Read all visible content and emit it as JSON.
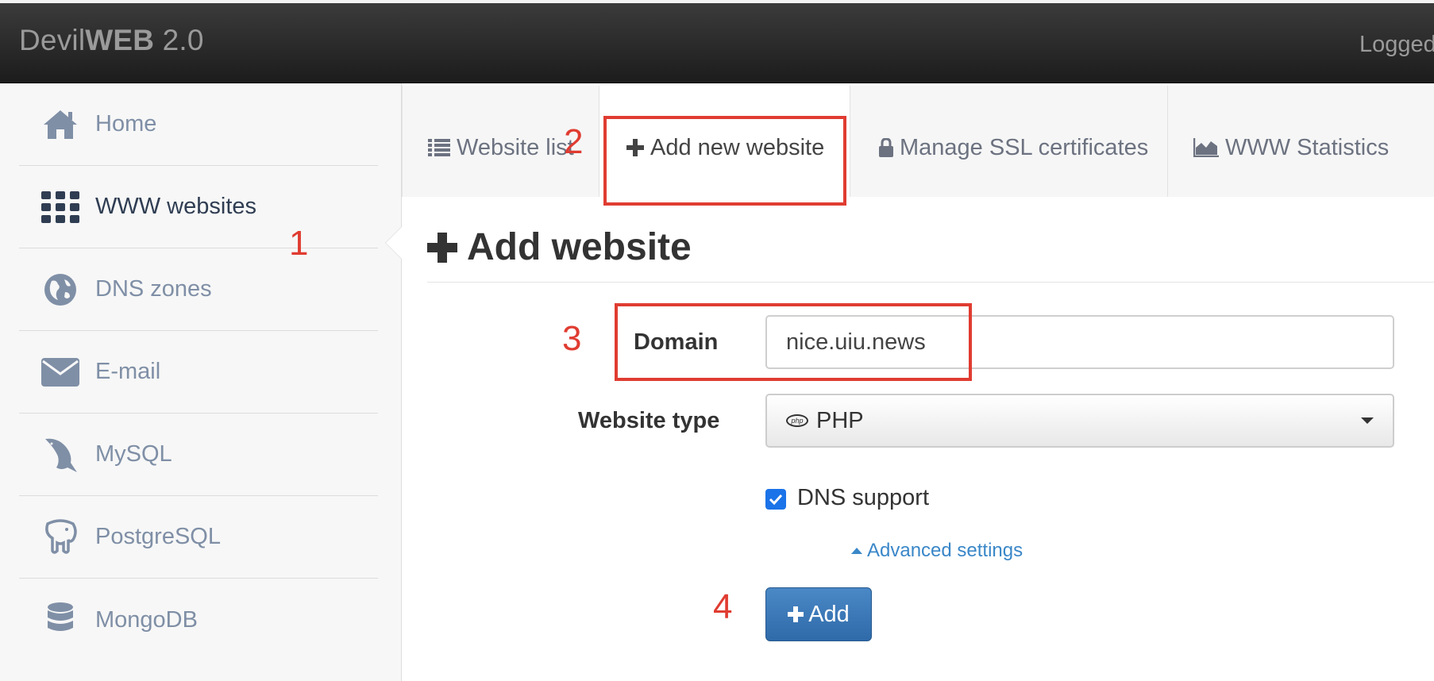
{
  "navbar": {
    "brand_light": "Devil",
    "brand_bold": "WEB",
    "brand_version": " 2.0",
    "logged_text": "Logged"
  },
  "sidebar": {
    "items": [
      {
        "label": "Home",
        "icon": "home-icon",
        "active": false
      },
      {
        "label": "WWW websites",
        "icon": "grid-icon",
        "active": true
      },
      {
        "label": "DNS zones",
        "icon": "globe-icon",
        "active": false
      },
      {
        "label": "E-mail",
        "icon": "envelope-icon",
        "active": false
      },
      {
        "label": "MySQL",
        "icon": "dolphin-icon",
        "active": false
      },
      {
        "label": "PostgreSQL",
        "icon": "elephant-icon",
        "active": false
      },
      {
        "label": "MongoDB",
        "icon": "database-icon",
        "active": false
      }
    ]
  },
  "tabs": [
    {
      "label": "Website list",
      "icon": "list-icon",
      "active": false
    },
    {
      "label": "Add new website",
      "icon": "plus-icon",
      "active": true
    },
    {
      "label": "Manage SSL certificates",
      "icon": "lock-icon",
      "active": false
    },
    {
      "label": "WWW Statistics",
      "icon": "area-chart-icon",
      "active": false
    }
  ],
  "annotations": [
    "1",
    "2",
    "3",
    "4"
  ],
  "main": {
    "title": "Add website",
    "domain_label": "Domain",
    "domain_value": "nice.uiu.news",
    "type_label": "Website type",
    "type_value": "PHP",
    "php_badge": "php",
    "dns_label": "DNS support",
    "dns_checked": true,
    "advanced_link": "Advanced settings",
    "add_button": "Add"
  },
  "colors": {
    "annotation": "#e03c31",
    "link": "#3a87c8",
    "button": "#3a78b8",
    "checkbox": "#1a73e8"
  }
}
